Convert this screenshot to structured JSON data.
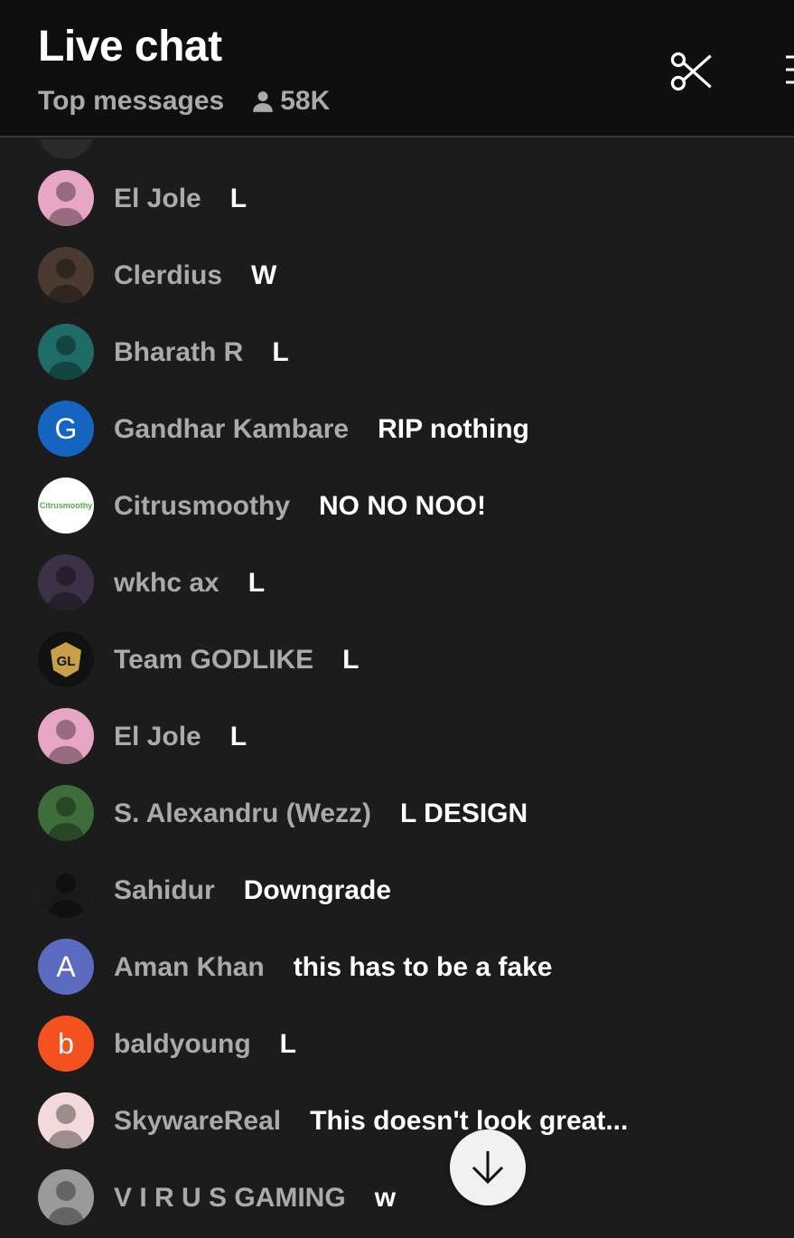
{
  "header": {
    "title": "Live chat",
    "mode": "Top messages",
    "viewers": "58K"
  },
  "messages": [
    {
      "author": "El Jole",
      "text": "L",
      "avatar": {
        "type": "image",
        "icon": "anime-avatar",
        "bg": "#e8a6c5"
      }
    },
    {
      "author": "Clerdius",
      "text": "W",
      "avatar": {
        "type": "image",
        "icon": "dark-hair-avatar",
        "bg": "#4a3a30"
      }
    },
    {
      "author": "Bharath R",
      "text": "L",
      "avatar": {
        "type": "image",
        "icon": "photo-avatar",
        "bg": "#1f6b66"
      }
    },
    {
      "author": "Gandhar Kambare",
      "text": "RIP nothing",
      "avatar": {
        "type": "letter",
        "letter": "G",
        "bg": "#1565c0"
      }
    },
    {
      "author": "Citrusmoothy",
      "text": "NO NO NOO!",
      "avatar": {
        "type": "logo",
        "logo_text": "Citrusmoothy",
        "bg": "#ffffff"
      }
    },
    {
      "author": "wkhc ax",
      "text": "L",
      "avatar": {
        "type": "image",
        "icon": "photo-avatar",
        "bg": "#3b3248"
      }
    },
    {
      "author": "Team GODLIKE",
      "text": "L",
      "avatar": {
        "type": "logo",
        "icon": "godlike-logo",
        "bg": "#111111"
      }
    },
    {
      "author": "El Jole",
      "text": "L",
      "avatar": {
        "type": "image",
        "icon": "anime-avatar",
        "bg": "#e8a6c5"
      }
    },
    {
      "author": "S. Alexandru (Wezz)",
      "text": "L DESIGN",
      "avatar": {
        "type": "image",
        "icon": "photo-avatar",
        "bg": "#3d6e3a"
      }
    },
    {
      "author": "Sahidur",
      "text": "Downgrade",
      "avatar": {
        "type": "image",
        "icon": "hooded-avatar",
        "bg": "#1a1a1a"
      }
    },
    {
      "author": "Aman Khan",
      "text": "this has to be a fake",
      "avatar": {
        "type": "letter",
        "letter": "A",
        "bg": "#5c6bc0"
      }
    },
    {
      "author": "baldyoung",
      "text": "L",
      "avatar": {
        "type": "letter",
        "letter": "b",
        "bg": "#f4511e"
      }
    },
    {
      "author": "SkywareReal",
      "text": "This doesn't look great...",
      "avatar": {
        "type": "image",
        "icon": "cartoon-avatar",
        "bg": "#f3d9d9"
      }
    },
    {
      "author": "V I R U S GAMING",
      "text": "w",
      "avatar": {
        "type": "image",
        "icon": "photo-avatar",
        "bg": "#9a9a9a"
      }
    }
  ]
}
